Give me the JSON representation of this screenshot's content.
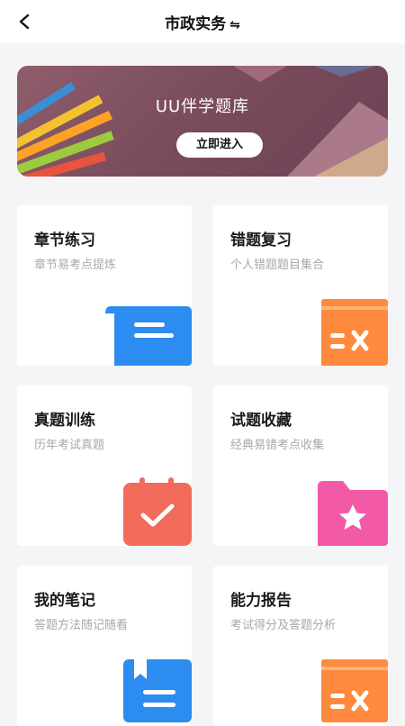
{
  "header": {
    "title": "市政实务",
    "swap_glyph": "⇋"
  },
  "banner": {
    "title": "UU伴学题库",
    "button_label": "立即进入"
  },
  "cards": [
    {
      "title": "章节练习",
      "subtitle": "章节易考点提炼",
      "icon": "scroll-list-icon",
      "color": "#2d8cf0"
    },
    {
      "title": "错题复习",
      "subtitle": "个人错题题目集合",
      "icon": "wrong-book-icon",
      "color": "#ff8a3d"
    },
    {
      "title": "真题训练",
      "subtitle": "历年考试真题",
      "icon": "clipboard-check-icon",
      "color": "#f26b5b"
    },
    {
      "title": "试题收藏",
      "subtitle": "经典易错考点收集",
      "icon": "star-folder-icon",
      "color": "#f25aa8"
    },
    {
      "title": "我的笔记",
      "subtitle": "答题方法随记随看",
      "icon": "notebook-icon",
      "color": "#2d8cf0"
    },
    {
      "title": "能力报告",
      "subtitle": "考试得分及答题分析",
      "icon": "report-book-icon",
      "color": "#ff8a3d"
    }
  ]
}
